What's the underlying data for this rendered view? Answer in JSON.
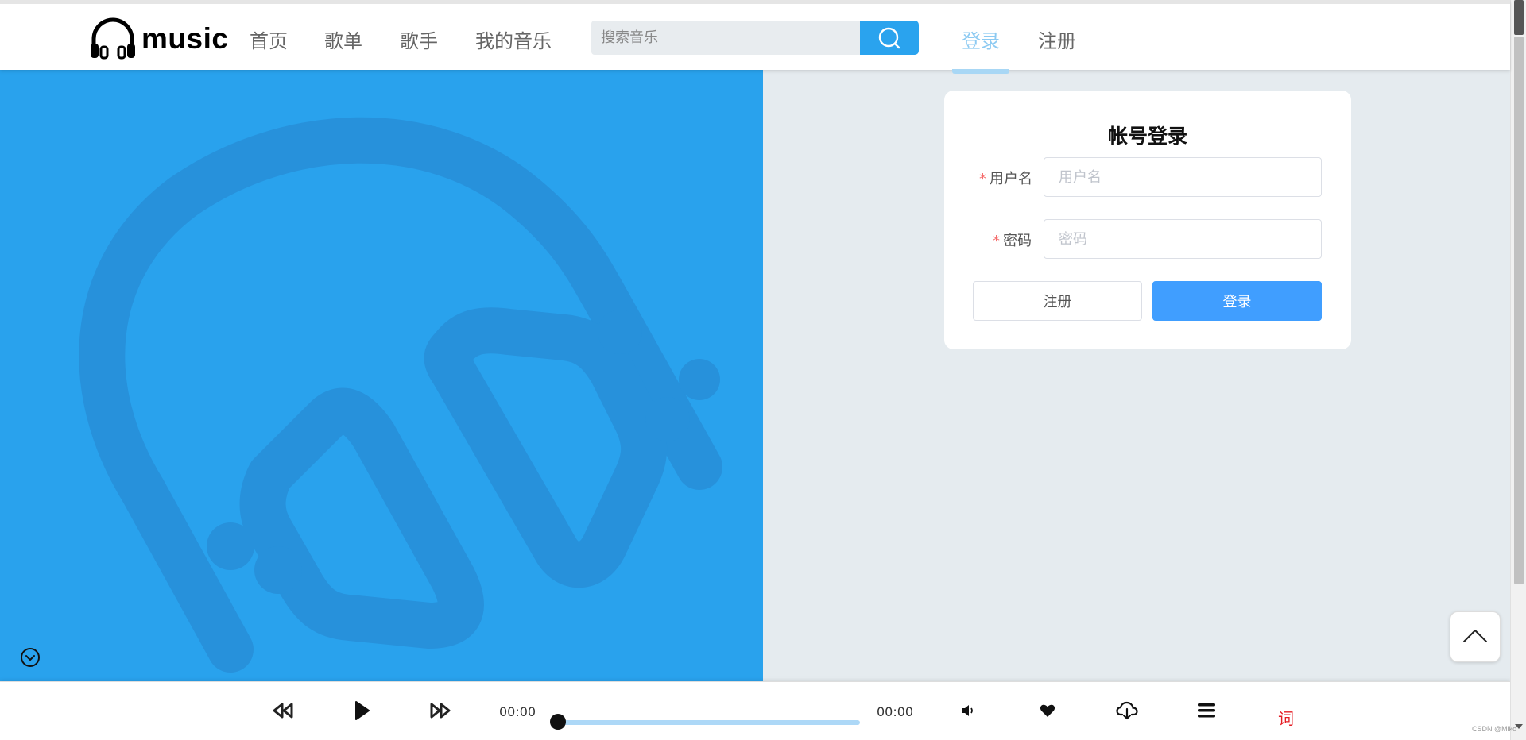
{
  "header": {
    "logo_text": "music",
    "nav": [
      {
        "label": "首页"
      },
      {
        "label": "歌单"
      },
      {
        "label": "歌手"
      },
      {
        "label": "我的音乐"
      }
    ],
    "search": {
      "placeholder": "搜索音乐"
    },
    "auth": {
      "login": "登录",
      "register": "注册"
    }
  },
  "login_card": {
    "title": "帐号登录",
    "username": {
      "label": "用户名",
      "placeholder": "用户名",
      "required_mark": "*"
    },
    "password": {
      "label": "密码",
      "placeholder": "密码",
      "required_mark": "*"
    },
    "register_button": "注册",
    "login_button": "登录"
  },
  "player": {
    "current_time": "00:00",
    "total_time": "00:00",
    "progress": 0,
    "lyric_label": "词"
  },
  "footer": {
    "watermark": "CSDN @Miko"
  },
  "colors": {
    "accent": "#29a2ed",
    "primary_button": "#409eff",
    "active_nav": "#8ccaf2",
    "lyric": "#e51c23"
  },
  "icons": {
    "logo": "headphones-icon",
    "search": "search-icon",
    "back_to_top": "chevron-up-icon",
    "collapse": "chevron-down-circle-icon",
    "prev": "rewind-icon",
    "play": "play-icon",
    "next": "fast-forward-icon",
    "volume": "volume-icon",
    "favorite": "heart-icon",
    "download": "cloud-download-icon",
    "playlist": "list-icon"
  }
}
